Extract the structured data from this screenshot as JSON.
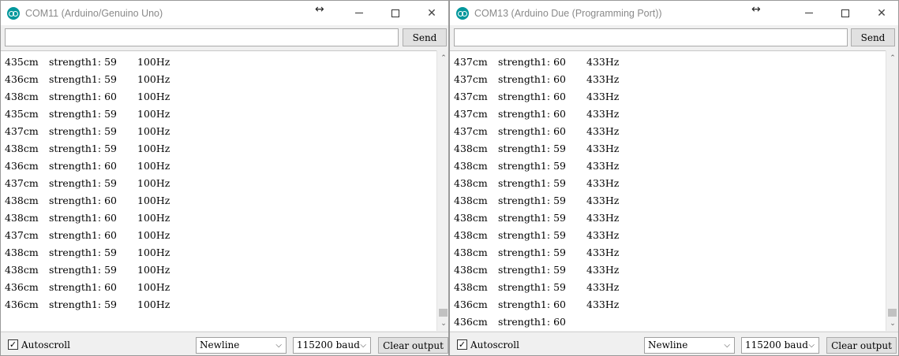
{
  "windows": [
    {
      "title": "COM11 (Arduino/Genuino Uno)",
      "send_input_value": "",
      "send_label": "Send",
      "lines": [
        [
          "435cm",
          "strength1: 59",
          "100Hz"
        ],
        [
          "436cm",
          "strength1: 59",
          "100Hz"
        ],
        [
          "438cm",
          "strength1: 60",
          "100Hz"
        ],
        [
          "435cm",
          "strength1: 59",
          "100Hz"
        ],
        [
          "437cm",
          "strength1: 59",
          "100Hz"
        ],
        [
          "438cm",
          "strength1: 59",
          "100Hz"
        ],
        [
          "436cm",
          "strength1: 60",
          "100Hz"
        ],
        [
          "437cm",
          "strength1: 59",
          "100Hz"
        ],
        [
          "438cm",
          "strength1: 60",
          "100Hz"
        ],
        [
          "438cm",
          "strength1: 60",
          "100Hz"
        ],
        [
          "437cm",
          "strength1: 60",
          "100Hz"
        ],
        [
          "438cm",
          "strength1: 59",
          "100Hz"
        ],
        [
          "438cm",
          "strength1: 59",
          "100Hz"
        ],
        [
          "436cm",
          "strength1: 60",
          "100Hz"
        ],
        [
          "436cm",
          "strength1: 59",
          "100Hz"
        ]
      ],
      "autoscroll_label": "Autoscroll",
      "autoscroll_checked": "✓",
      "line_ending": "Newline",
      "baud": "115200 baud",
      "clear_label": "Clear output"
    },
    {
      "title": "COM13 (Arduino Due (Programming Port))",
      "send_input_value": "",
      "send_label": "Send",
      "lines": [
        [
          "437cm",
          "strength1: 60",
          "433Hz"
        ],
        [
          "437cm",
          "strength1: 60",
          "433Hz"
        ],
        [
          "437cm",
          "strength1: 60",
          "433Hz"
        ],
        [
          "437cm",
          "strength1: 60",
          "433Hz"
        ],
        [
          "437cm",
          "strength1: 60",
          "433Hz"
        ],
        [
          "438cm",
          "strength1: 59",
          "433Hz"
        ],
        [
          "438cm",
          "strength1: 59",
          "433Hz"
        ],
        [
          "438cm",
          "strength1: 59",
          "433Hz"
        ],
        [
          "438cm",
          "strength1: 59",
          "433Hz"
        ],
        [
          "438cm",
          "strength1: 59",
          "433Hz"
        ],
        [
          "438cm",
          "strength1: 59",
          "433Hz"
        ],
        [
          "438cm",
          "strength1: 59",
          "433Hz"
        ],
        [
          "438cm",
          "strength1: 59",
          "433Hz"
        ],
        [
          "438cm",
          "strength1: 59",
          "433Hz"
        ],
        [
          "436cm",
          "strength1: 60",
          "433Hz"
        ],
        [
          "436cm",
          "strength1: 60",
          ""
        ]
      ],
      "autoscroll_label": "Autoscroll",
      "autoscroll_checked": "✓",
      "line_ending": "Newline",
      "baud": "115200 baud",
      "clear_label": "Clear output"
    }
  ],
  "icons": {
    "app": "arduino-logo-icon",
    "resize": "↔",
    "close": "✕",
    "scroll_up": "⌃",
    "scroll_down": "⌄",
    "dropdown": "⌵"
  },
  "colors": {
    "accent": "#00979c",
    "title_text": "#8a8a8a"
  }
}
